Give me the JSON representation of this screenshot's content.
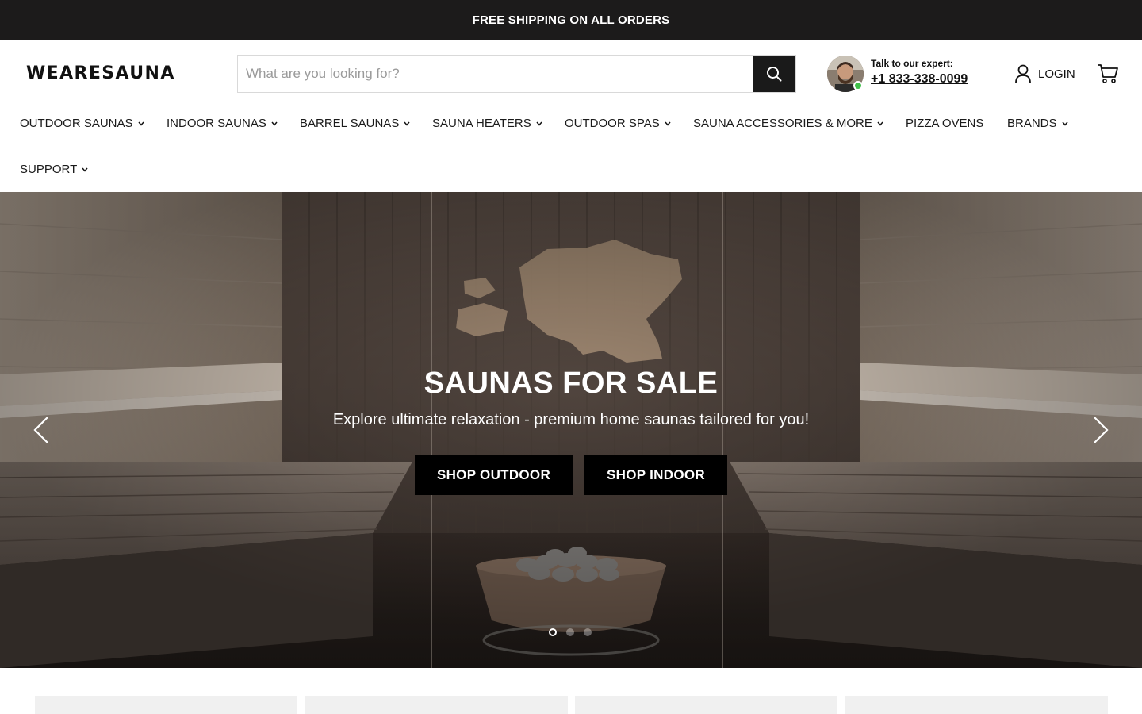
{
  "announcement": "FREE SHIPPING ON ALL ORDERS",
  "header": {
    "logo": "WEARESAUNA",
    "search_placeholder": "What are you looking for?",
    "expert_label": "Talk to our expert:",
    "expert_phone": "+1 833-338-0099",
    "login_label": "LOGIN"
  },
  "nav": {
    "items": [
      {
        "label": "OUTDOOR SAUNAS",
        "dropdown": true
      },
      {
        "label": "INDOOR SAUNAS",
        "dropdown": true
      },
      {
        "label": "BARREL SAUNAS",
        "dropdown": true
      },
      {
        "label": "SAUNA HEATERS",
        "dropdown": true
      },
      {
        "label": "OUTDOOR SPAS",
        "dropdown": true
      },
      {
        "label": "SAUNA ACCESSORIES & MORE",
        "dropdown": true
      },
      {
        "label": "PIZZA OVENS",
        "dropdown": false
      },
      {
        "label": "BRANDS",
        "dropdown": true
      },
      {
        "label": "SUPPORT",
        "dropdown": true
      }
    ]
  },
  "hero": {
    "title": "SAUNAS FOR SALE",
    "subtitle": "Explore ultimate relaxation - premium home saunas tailored for you!",
    "btn_outdoor": "SHOP OUTDOOR",
    "btn_indoor": "SHOP INDOOR",
    "slide_count": 3,
    "active_slide": 1
  },
  "colors": {
    "announcement_bg": "#1c1b1b",
    "button_bg": "#000000",
    "online_dot": "#3fc04a"
  },
  "icons": [
    "search-icon",
    "user-icon",
    "cart-icon",
    "chevron-down-icon",
    "chevron-left-icon",
    "chevron-right-icon"
  ]
}
